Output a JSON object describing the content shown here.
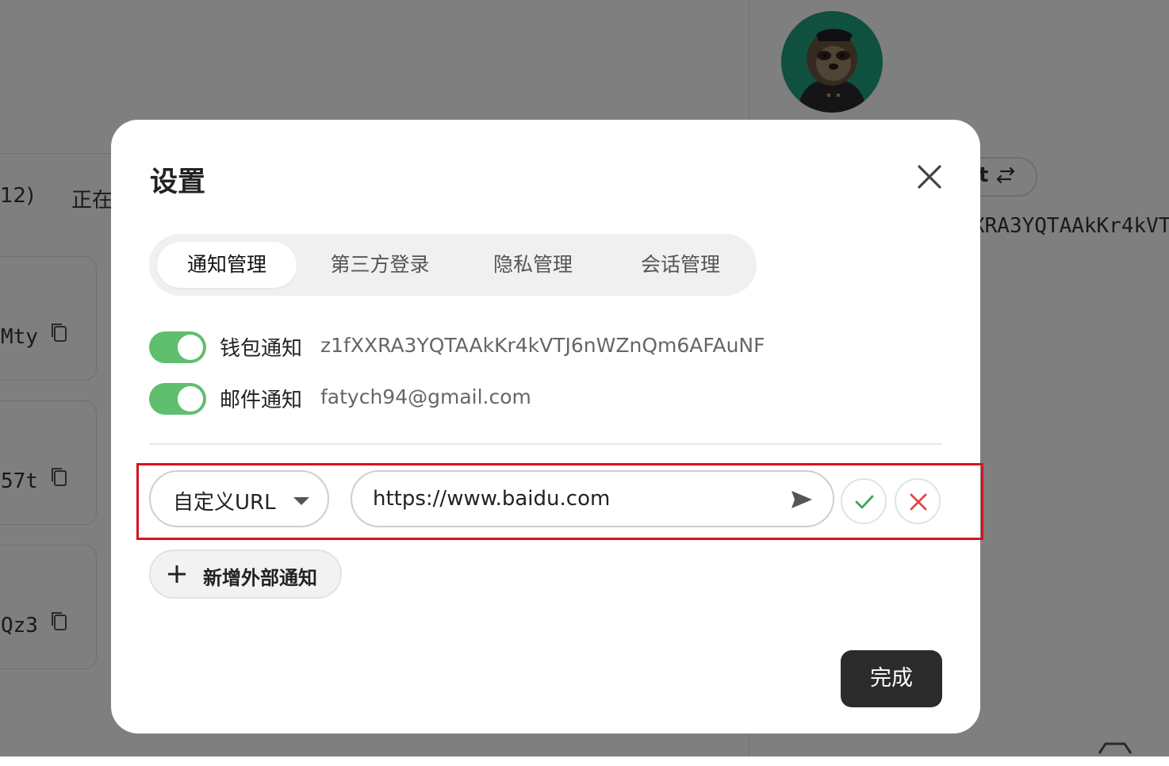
{
  "background": {
    "left_text_partial": "12)",
    "left_status_partial": "正在",
    "card_texts": [
      "Mty",
      "57t",
      "Qz3"
    ],
    "pill_partial": "t",
    "address_partial": "XRA3YQTAAkKr4kVT"
  },
  "modal": {
    "title": "设置",
    "tabs": [
      {
        "label": "通知管理",
        "active": true
      },
      {
        "label": "第三方登录",
        "active": false
      },
      {
        "label": "隐私管理",
        "active": false
      },
      {
        "label": "会话管理",
        "active": false
      }
    ],
    "notifications": [
      {
        "label": "钱包通知",
        "value": "z1fXXRA3YQTAAkKr4kVTJ6nWZnQm6AFAuNF",
        "enabled": true
      },
      {
        "label": "邮件通知",
        "value": "fatych94@gmail.com",
        "enabled": true
      }
    ],
    "custom_url": {
      "type_label": "自定义URL",
      "url_value": "https://www.baidu.com"
    },
    "add_external_label": "新增外部通知",
    "done_label": "完成"
  },
  "colors": {
    "toggle_on": "#5fbf6f",
    "highlight_border": "#d9121e",
    "confirm": "#3aa757",
    "cancel": "#e04848",
    "done_bg": "#2b2b2b"
  }
}
